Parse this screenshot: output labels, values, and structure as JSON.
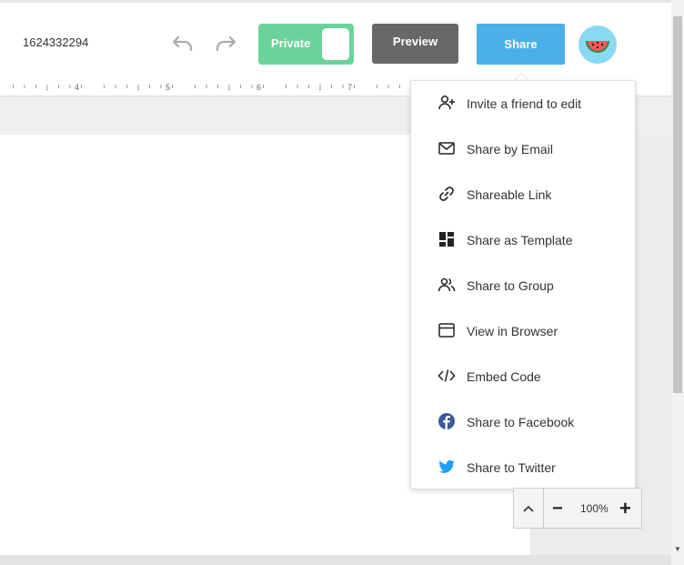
{
  "header": {
    "doc_id": "1624332294",
    "private_label": "Private",
    "preview_label": "Preview",
    "share_label": "Share"
  },
  "ruler": {
    "numbers": [
      "4",
      "5",
      "6",
      "7"
    ]
  },
  "share_menu": {
    "items": [
      {
        "label": "Invite a friend to edit",
        "icon": "add-user-icon"
      },
      {
        "label": "Share by Email",
        "icon": "mail-icon"
      },
      {
        "label": "Shareable Link",
        "icon": "link-icon"
      },
      {
        "label": "Share as Template",
        "icon": "template-icon"
      },
      {
        "label": "Share to Group",
        "icon": "group-icon"
      },
      {
        "label": "View in Browser",
        "icon": "browser-icon"
      },
      {
        "label": "Embed Code",
        "icon": "code-icon"
      },
      {
        "label": "Share to Facebook",
        "icon": "facebook-icon"
      },
      {
        "label": "Share to Twitter",
        "icon": "twitter-icon"
      }
    ]
  },
  "zoom": {
    "value": "100%",
    "minus": "−",
    "plus": "+"
  },
  "colors": {
    "private": "#6bd39a",
    "preview": "#686868",
    "share": "#4ab0e8",
    "facebook": "#3b5998",
    "twitter": "#1da1f2"
  }
}
